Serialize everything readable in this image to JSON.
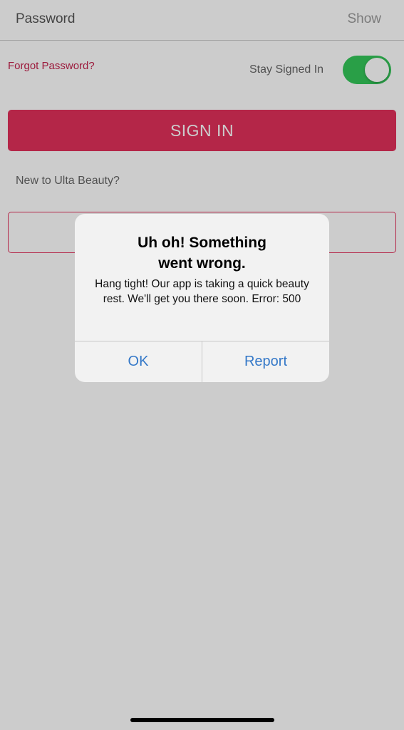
{
  "form": {
    "password_label": "Password",
    "show_label": "Show",
    "forgot_label": "Forgot Password?",
    "stay_signed_in_label": "Stay Signed In",
    "stay_signed_in_on": true,
    "signin_label": "SIGN IN",
    "new_label": "New to Ulta Beauty?",
    "create_account_label": ""
  },
  "alert": {
    "title": "Uh oh! Something went wrong.",
    "message": "Hang tight! Our app is taking a quick beauty rest. We'll get you there soon. Error: 500",
    "ok_label": "OK",
    "report_label": "Report"
  },
  "colors": {
    "brand": "#e1305a",
    "toggle_on": "#34c759",
    "alert_button": "#3478c8"
  }
}
